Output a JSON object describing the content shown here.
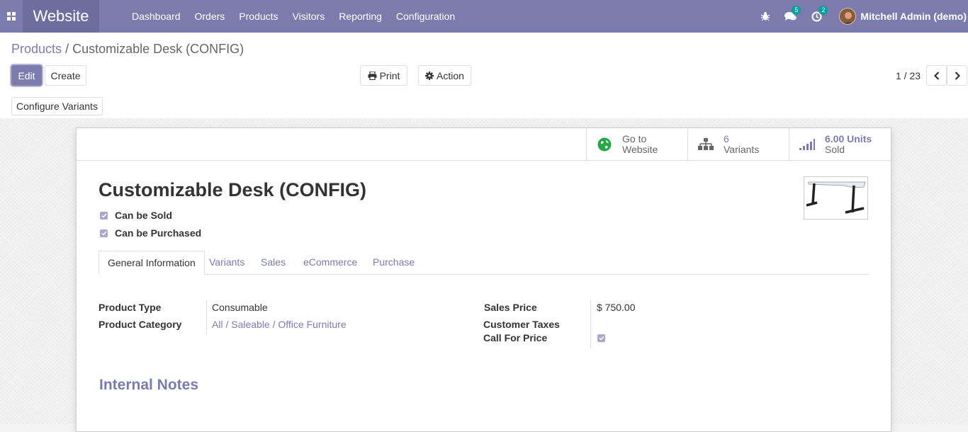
{
  "navbar": {
    "app_name": "Website",
    "menu": [
      "Dashboard",
      "Orders",
      "Products",
      "Visitors",
      "Reporting",
      "Configuration"
    ],
    "messages_count": "5",
    "activities_count": "2",
    "user_name": "Mitchell Admin (demo)",
    "icons": [
      "apps-icon",
      "bug-icon",
      "chat-icon",
      "clock-icon"
    ]
  },
  "breadcrumb": {
    "parent": "Products",
    "separator": "/",
    "current": "Customizable Desk (CONFIG)"
  },
  "buttons": {
    "edit": "Edit",
    "create": "Create",
    "print": "Print",
    "action": "Action",
    "configure_variants": "Configure Variants"
  },
  "pager": {
    "value": "1 / 23"
  },
  "smart_buttons": [
    {
      "line1": "Go to",
      "line2": "Website",
      "icon": "globe-icon"
    },
    {
      "line1": "6",
      "line2": "Variants",
      "icon": "sitemap-icon"
    },
    {
      "line1": "6.00 Units",
      "line2": "Sold",
      "icon": "signal-icon"
    }
  ],
  "product": {
    "name": "Customizable Desk (CONFIG)",
    "can_be_sold": "Can be Sold",
    "can_be_purchased": "Can be Purchased"
  },
  "tabs": [
    "General Information",
    "Variants",
    "Sales",
    "eCommerce",
    "Purchase"
  ],
  "general": {
    "product_type_label": "Product Type",
    "product_type": "Consumable",
    "product_category_label": "Product Category",
    "product_category": "All / Saleable / Office Furniture",
    "sales_price_label": "Sales Price",
    "sales_price": "$ 750.00",
    "customer_taxes_label": "Customer Taxes",
    "call_for_price_label": "Call For Price"
  },
  "notes_title": "Internal Notes",
  "colors": {
    "brand": "#7c7bad",
    "brand_dark": "#6e6d9f",
    "badge": "#00a09d",
    "globe": "#28a745"
  }
}
